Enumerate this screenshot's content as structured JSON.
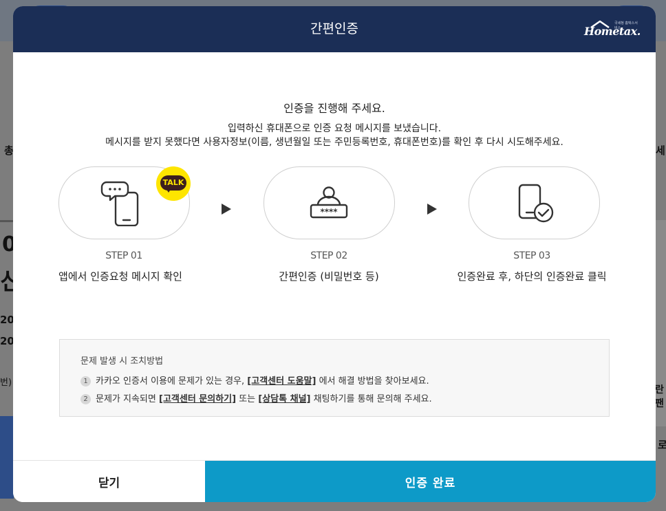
{
  "modal": {
    "title": "간편인증",
    "logo_text": "Hometax.",
    "logo_small": "국세청 홈택스서비스"
  },
  "messages": {
    "main": "인증을 진행해 주세요.",
    "sub_line1": "입력하신 휴대폰으로 인증 요청 메시지를 보냈습니다.",
    "sub_line2": "메시지를 받지 못했다면 사용자정보(이름, 생년월일 또는 주민등록번호, 휴대폰번호)를 확인 후 다시 시도해주세요."
  },
  "steps": [
    {
      "label": "STEP 01",
      "description": "앱에서 인증요청 메시지 확인",
      "icon": "chat-phone-icon"
    },
    {
      "label": "STEP 02",
      "description": "간편인증 (비밀번호 등)",
      "icon": "password-user-icon"
    },
    {
      "label": "STEP 03",
      "description": "인증완료 후, 하단의 인증완료 클릭",
      "icon": "phone-check-icon"
    }
  ],
  "talk_badge": {
    "text": "TALK",
    "bg_color": "#fee500",
    "text_bg_color": "#3c1e1e"
  },
  "troubleshoot": {
    "title": "문제 발생 시 조치방법",
    "items": [
      {
        "num": "1",
        "before": "카카오 인증서 이용에 문제가 있는 경우, ",
        "link1": "[고객센터 도움말]",
        "after": " 에서 해결 방법을 찾아보세요."
      },
      {
        "num": "2",
        "before": "문제가 지속되면 ",
        "link1": "[고객센터 문의하기]",
        "middle": " 또는 ",
        "link2": "[상담톡 채널]",
        "after": " 채팅하기를 통해 문의해 주세요."
      }
    ]
  },
  "buttons": {
    "close": "닫기",
    "confirm": "인증 완료"
  },
  "background_fragments": {
    "f1": "총",
    "f2": "세",
    "f3": "0",
    "f4": "신",
    "f5": "20",
    "f6": "20",
    "f7": "번)",
    "f8": "란팬",
    "f9": "로"
  },
  "colors": {
    "header_bg": "#1b2e56",
    "confirm_bg": "#0d9ac8",
    "overlay": "#7d7d7d"
  }
}
